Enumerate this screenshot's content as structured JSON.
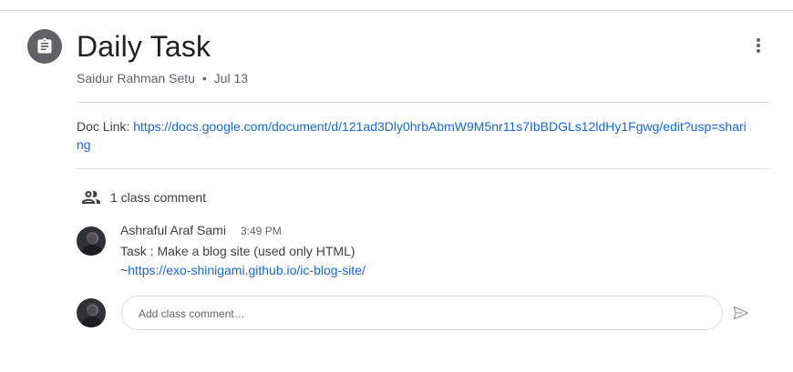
{
  "post": {
    "title": "Daily Task",
    "author": "Saidur Rahman Setu",
    "separator": "•",
    "date": "Jul 13",
    "doc_label": "Doc Link: ",
    "doc_url": "https://docs.google.com/document/d/121ad3Dly0hrbAbmW9M5nr11s7IbBDGLs12ldHy1Fgwg/edit?usp=sharing"
  },
  "comments": {
    "count_label": "1 class comment",
    "items": [
      {
        "author": "Ashraful Araf Sami",
        "time": "3:49 PM",
        "line1": "Task : Make a blog site (used only HTML)",
        "prefix": "~",
        "link": "https://exo-shinigami.github.io/ic-blog-site/"
      }
    ],
    "input_placeholder": "Add class comment…"
  },
  "icons": {
    "assignment": "assignment-icon",
    "more": "more-vert-icon",
    "people": "people-icon",
    "send": "send-icon"
  },
  "colors": {
    "link": "#1967d2",
    "icon_bg": "#5f6368",
    "text": "#3c4043"
  }
}
